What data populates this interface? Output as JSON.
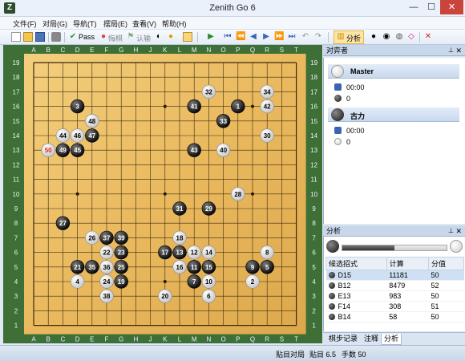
{
  "window": {
    "title": "Zenith Go 6",
    "app_icon": "Z",
    "minimize": "—",
    "maximize": "☐",
    "close": "✕"
  },
  "menu": [
    "文件(F)",
    "对局(G)",
    "导航(T)",
    "摆局(E)",
    "查看(V)",
    "帮助(H)"
  ],
  "toolbar": {
    "pass_label": "Pass",
    "resign_label": "悔棋",
    "confirm_label": "认输",
    "analysis_label": "分析"
  },
  "board": {
    "columns": [
      "A",
      "B",
      "C",
      "D",
      "E",
      "F",
      "G",
      "H",
      "J",
      "K",
      "L",
      "M",
      "N",
      "O",
      "P",
      "Q",
      "R",
      "S",
      "T"
    ],
    "rows": [
      "19",
      "18",
      "17",
      "16",
      "15",
      "14",
      "13",
      "12",
      "11",
      "10",
      "9",
      "8",
      "7",
      "6",
      "5",
      "4",
      "3",
      "2",
      "1"
    ],
    "stones": [
      {
        "n": "1",
        "c": "b",
        "p": "P16"
      },
      {
        "n": "2",
        "c": "w",
        "p": "Q4"
      },
      {
        "n": "3",
        "c": "b",
        "p": "D16"
      },
      {
        "n": "4",
        "c": "w",
        "p": "D4"
      },
      {
        "n": "5",
        "c": "b",
        "p": "R5"
      },
      {
        "n": "6",
        "c": "w",
        "p": "N3"
      },
      {
        "n": "7",
        "c": "b",
        "p": "M4"
      },
      {
        "n": "8",
        "c": "w",
        "p": "R6"
      },
      {
        "n": "9",
        "c": "b",
        "p": "Q5"
      },
      {
        "n": "10",
        "c": "w",
        "p": "N4"
      },
      {
        "n": "11",
        "c": "b",
        "p": "M5"
      },
      {
        "n": "12",
        "c": "w",
        "p": "M6"
      },
      {
        "n": "13",
        "c": "b",
        "p": "L6"
      },
      {
        "n": "14",
        "c": "w",
        "p": "N6"
      },
      {
        "n": "15",
        "c": "b",
        "p": "N5"
      },
      {
        "n": "16",
        "c": "w",
        "p": "L5"
      },
      {
        "n": "17",
        "c": "b",
        "p": "K6"
      },
      {
        "n": "18",
        "c": "w",
        "p": "L7"
      },
      {
        "n": "19",
        "c": "b",
        "p": "G4"
      },
      {
        "n": "20",
        "c": "w",
        "p": "K3"
      },
      {
        "n": "21",
        "c": "b",
        "p": "D5"
      },
      {
        "n": "22",
        "c": "w",
        "p": "F6"
      },
      {
        "n": "23",
        "c": "b",
        "p": "G6"
      },
      {
        "n": "24",
        "c": "w",
        "p": "F4"
      },
      {
        "n": "25",
        "c": "b",
        "p": "G5"
      },
      {
        "n": "26",
        "c": "w",
        "p": "E7"
      },
      {
        "n": "27",
        "c": "b",
        "p": "C8"
      },
      {
        "n": "28",
        "c": "w",
        "p": "P10"
      },
      {
        "n": "29",
        "c": "b",
        "p": "N9"
      },
      {
        "n": "30",
        "c": "w",
        "p": "R14"
      },
      {
        "n": "31",
        "c": "b",
        "p": "L9"
      },
      {
        "n": "32",
        "c": "w",
        "p": "N17"
      },
      {
        "n": "33",
        "c": "b",
        "p": "O15"
      },
      {
        "n": "34",
        "c": "w",
        "p": "R17"
      },
      {
        "n": "35",
        "c": "b",
        "p": "E5"
      },
      {
        "n": "36",
        "c": "w",
        "p": "F5"
      },
      {
        "n": "37",
        "c": "b",
        "p": "F7"
      },
      {
        "n": "38",
        "c": "w",
        "p": "F3"
      },
      {
        "n": "39",
        "c": "b",
        "p": "G7"
      },
      {
        "n": "40",
        "c": "w",
        "p": "O13"
      },
      {
        "n": "41",
        "c": "b",
        "p": "M16"
      },
      {
        "n": "42",
        "c": "w",
        "p": "R16"
      },
      {
        "n": "43",
        "c": "b",
        "p": "M13"
      },
      {
        "n": "44",
        "c": "w",
        "p": "C14"
      },
      {
        "n": "45",
        "c": "b",
        "p": "D13"
      },
      {
        "n": "46",
        "c": "w",
        "p": "D14"
      },
      {
        "n": "47",
        "c": "b",
        "p": "E14"
      },
      {
        "n": "48",
        "c": "w",
        "p": "E15"
      },
      {
        "n": "49",
        "c": "b",
        "p": "C13"
      },
      {
        "n": "50",
        "c": "w",
        "p": "B13",
        "last": true
      }
    ]
  },
  "players_panel": {
    "title": "对弈者",
    "white": {
      "name": "Master",
      "time": "00:00",
      "captures": "0"
    },
    "black": {
      "name": "古力",
      "time": "00:00",
      "captures": "0"
    }
  },
  "analysis_panel": {
    "title": "分析",
    "win_bar_fraction": 0.5,
    "headers": [
      "候选招式",
      "计算",
      "分值"
    ],
    "rows": [
      {
        "move": "D15",
        "count": "11181",
        "score": "50"
      },
      {
        "move": "B12",
        "count": "8479",
        "score": "52"
      },
      {
        "move": "E13",
        "count": "983",
        "score": "50"
      },
      {
        "move": "F14",
        "count": "308",
        "score": "51"
      },
      {
        "move": "B14",
        "count": "58",
        "score": "50"
      }
    ]
  },
  "tabs": [
    "棋步记录",
    "注释",
    "分析"
  ],
  "status": {
    "rule": "贴目对局",
    "komi": "贴目 6.5",
    "moves": "手数 50"
  }
}
